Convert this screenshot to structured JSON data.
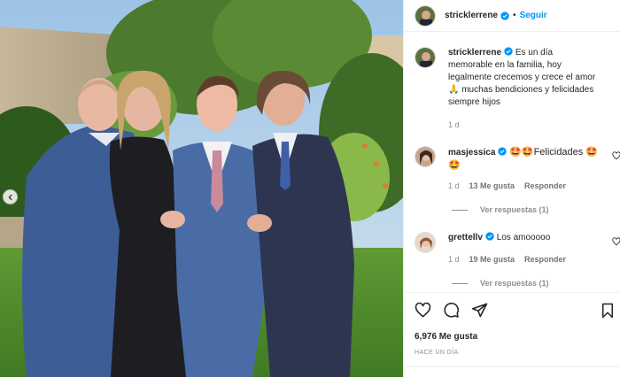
{
  "post": {
    "username": "stricklerrene",
    "follow_label": "Seguir",
    "caption": "Es un día memorable en la familia, hoy legalmente crecemos y crece el amor 🙏 muchas bendiciones y felicidades siempre hijos",
    "caption_age": "1 d",
    "likes": "6,976 Me gusta",
    "timestamp": "HACE UN DÍA"
  },
  "comments": [
    {
      "username": "masjessica",
      "text": "🤩🤩Felicidades 🤩🤩",
      "age": "1 d",
      "likes": "13 Me gusta",
      "reply_label": "Responder",
      "view_replies": "Ver respuestas (1)"
    },
    {
      "username": "grettellv",
      "text": "Los amooooo",
      "age": "1 d",
      "likes": "19 Me gusta",
      "reply_label": "Responder",
      "view_replies": "Ver respuestas (1)"
    }
  ],
  "icons": {
    "verified": "verified-badge-icon",
    "like": "heart-icon",
    "comment": "comment-icon",
    "share": "share-icon",
    "save": "bookmark-icon",
    "prev": "chevron-left-icon"
  },
  "colors": {
    "accent": "#0095f6",
    "text": "#262626",
    "muted": "#8e8e8e"
  }
}
